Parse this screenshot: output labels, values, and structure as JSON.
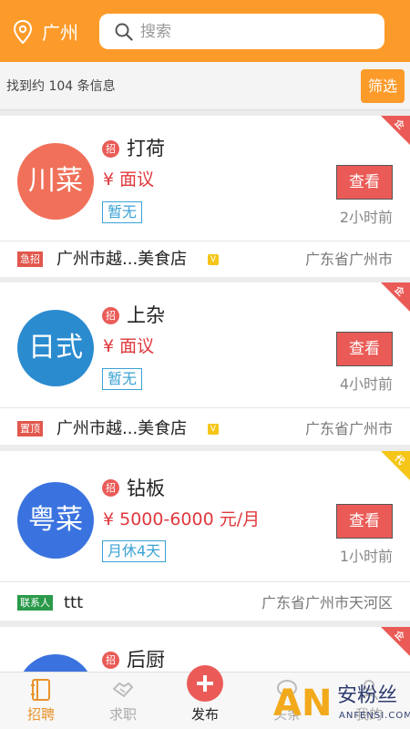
{
  "header": {
    "city": "广州",
    "search_placeholder": "搜索"
  },
  "infobar": {
    "count_text": "找到约 104 条信息",
    "filter_label": "筛选"
  },
  "jobs": [
    {
      "avatar": "川菜",
      "avatar_color": "#f0705a",
      "badge": "招",
      "title": "打荷",
      "salary": "¥  面议",
      "tag": "暂无",
      "view": "查看",
      "time": "2小时前",
      "mark": "急招",
      "mark_color": "#e2574c",
      "company": "广州市越...美食店",
      "company_verified": "V",
      "region": "广东省广州市",
      "corner": "企",
      "corner_color": "#ea5b57"
    },
    {
      "avatar": "日式",
      "avatar_color": "#2b8bcf",
      "badge": "招",
      "title": "上杂",
      "salary": "¥  面议",
      "tag": "暂无",
      "view": "查看",
      "time": "4小时前",
      "mark": "置顶",
      "mark_color": "#e2574c",
      "company": "广州市越...美食店",
      "company_verified": "V",
      "region": "广东省广州市",
      "corner": "企",
      "corner_color": "#ea5b57"
    },
    {
      "avatar": "粤菜",
      "avatar_color": "#3a73df",
      "badge": "招",
      "title": "钻板",
      "salary": "¥  5000-6000 元/月",
      "tag": "月休4天",
      "view": "查看",
      "time": "1小时前",
      "mark": "联系人",
      "mark_color": "#2a9a4a",
      "company": "ttt",
      "region": "广东省广州市天河区",
      "corner": "代",
      "corner_color": "#f5c518"
    },
    {
      "avatar": "",
      "avatar_color": "#3a73df",
      "badge": "招",
      "title": "后厨",
      "corner": "企",
      "corner_color": "#ea5b57"
    }
  ],
  "tabs": [
    {
      "label": "招聘",
      "icon": "recruit-icon"
    },
    {
      "label": "求职",
      "icon": "handshake-icon"
    },
    {
      "label": "发布",
      "icon": "plus-icon"
    },
    {
      "label": "头条",
      "icon": "chat-icon"
    },
    {
      "label": "我的",
      "icon": "user-icon"
    }
  ],
  "watermark": {
    "logo": "AN",
    "cn": "安粉丝",
    "en": "ANFENSI.COM"
  }
}
